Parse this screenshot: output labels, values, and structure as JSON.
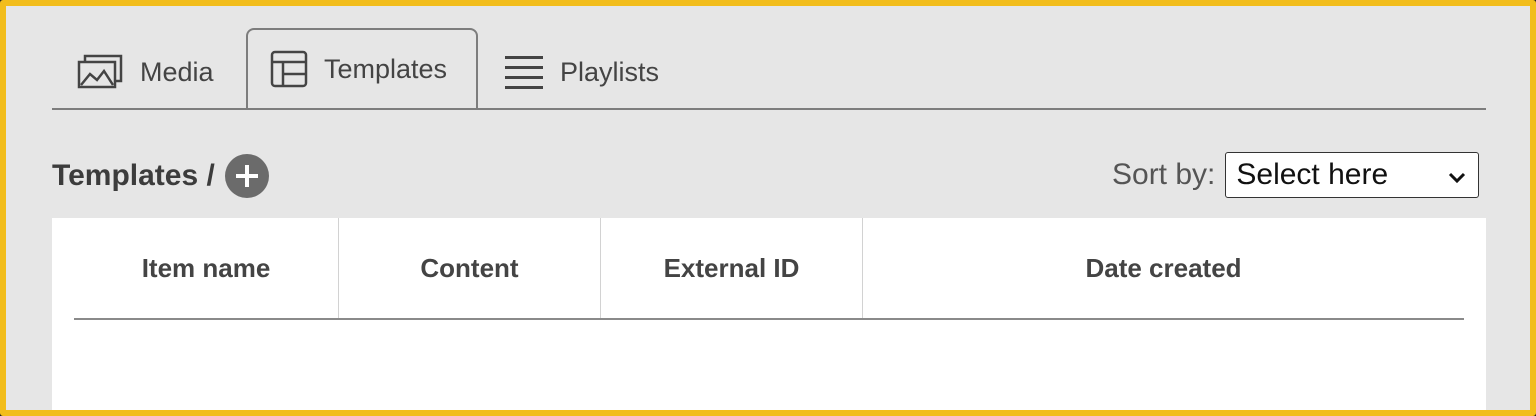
{
  "tabs": [
    {
      "label": "Media",
      "icon": "media-icon"
    },
    {
      "label": "Templates",
      "icon": "templates-icon",
      "active": true
    },
    {
      "label": "Playlists",
      "icon": "playlists-icon"
    }
  ],
  "section": {
    "title": "Templates /",
    "add_icon": "plus-circle-icon"
  },
  "sort": {
    "label": "Sort by:",
    "selected": "Select here"
  },
  "table": {
    "columns": [
      "Item name",
      "Content",
      "External ID",
      "Date created"
    ],
    "rows": []
  },
  "colors": {
    "frame": "#f2bd1c",
    "background": "#e6e6e6",
    "add_button": "#6b6b6b"
  }
}
